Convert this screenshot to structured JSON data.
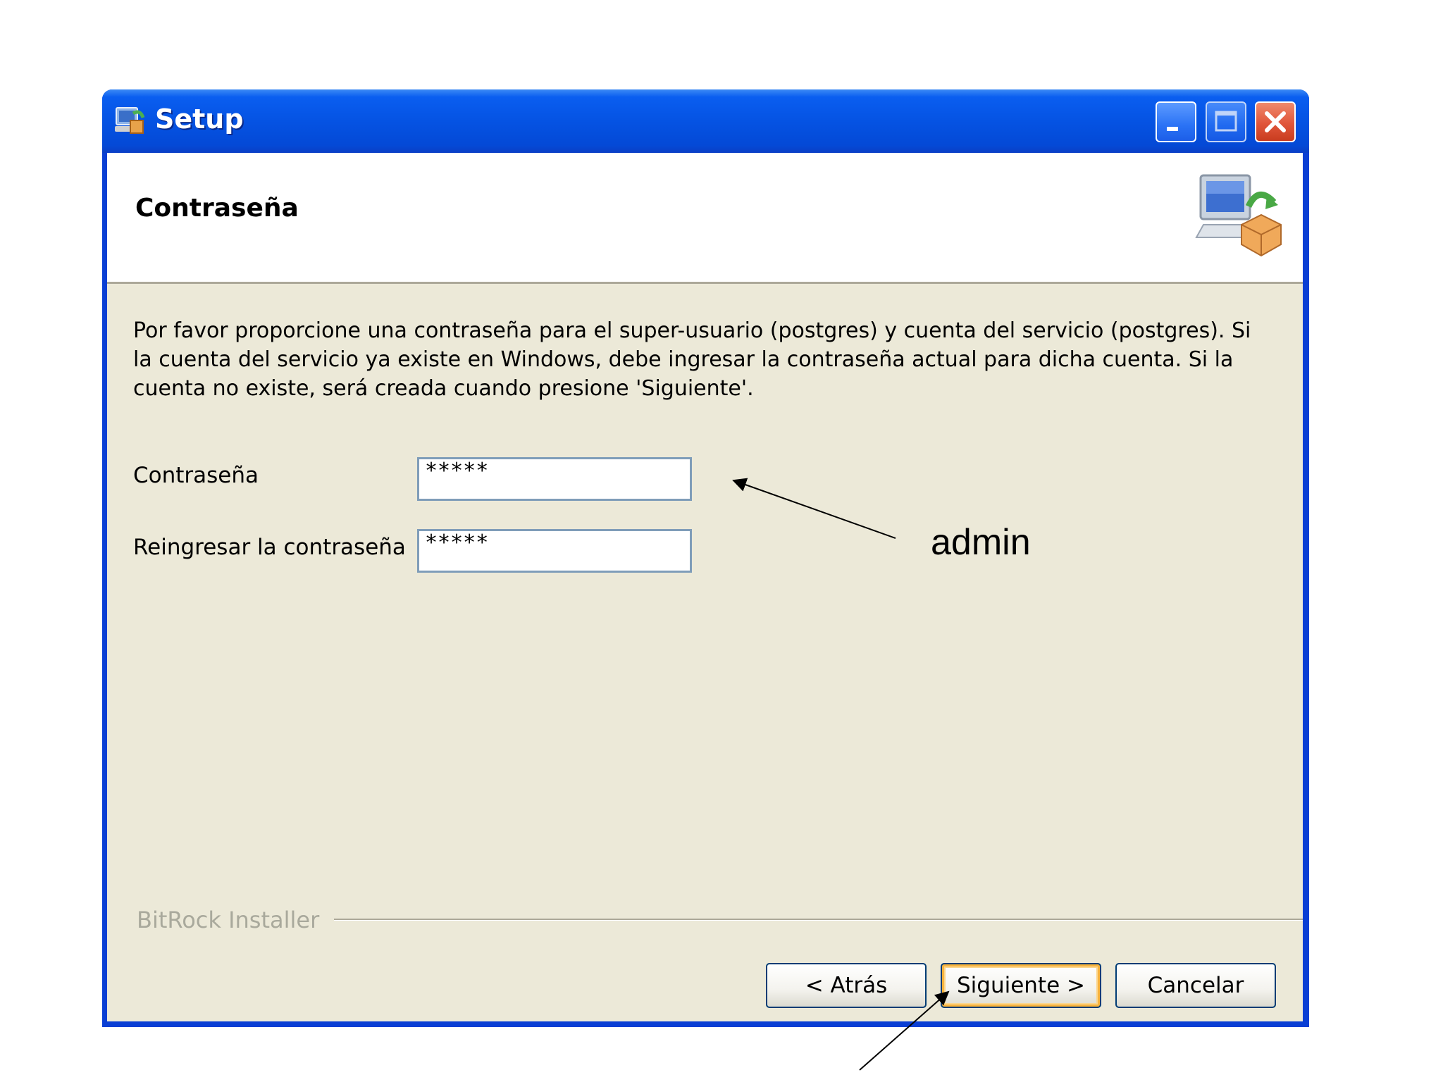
{
  "window": {
    "title": "Setup",
    "app_icon": "installer-icon",
    "buttons": [
      "minimize-icon",
      "maximize-icon",
      "close-icon"
    ]
  },
  "header": {
    "title": "Contraseña",
    "icon": "computer-package-icon"
  },
  "description": "Por favor proporcione una contraseña para el super-usuario (postgres) y cuenta del servicio (postgres). Si la cuenta del servicio ya existe en Windows, debe ingresar la contraseña actual para dicha cuenta. Si la cuenta no existe, será creada cuando presione 'Siguiente'.",
  "form": {
    "password_label": "Contraseña",
    "password_value": "*****",
    "confirm_label": "Reingresar la contraseña",
    "confirm_value": "*****"
  },
  "footer": {
    "brand": "BitRock Installer",
    "back_label": "< Atrás",
    "next_label": "Siguiente >",
    "cancel_label": "Cancelar"
  },
  "annotation": {
    "text": "admin"
  },
  "colors": {
    "titlebar": "#0553e3",
    "client_bg": "#ece9d8",
    "focus_ring": "#f8b33d"
  }
}
